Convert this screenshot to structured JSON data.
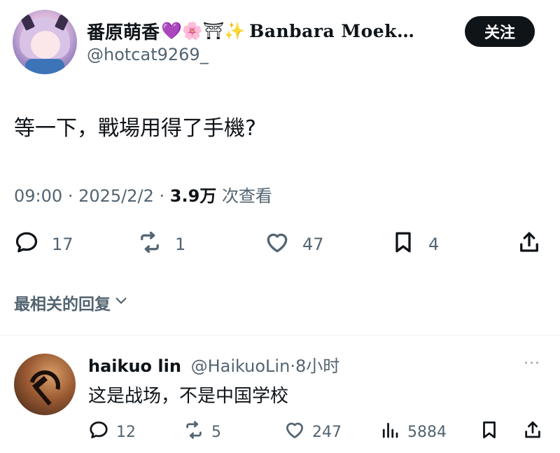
{
  "author": {
    "display_name": "番原萌香",
    "emojis": "💜🌸⛩✨",
    "name_suffix": "Banbara Moek…",
    "handle": "@hotcat9269_"
  },
  "follow_label": "关注",
  "tweet": {
    "text": "等一下，戰場用得了手機?",
    "time": "09:00",
    "date": "2025/2/2",
    "views_count": "3.9万",
    "views_label": "次查看"
  },
  "actions": {
    "replies": "17",
    "retweets": "1",
    "likes": "47",
    "bookmarks": "4"
  },
  "replies_sort_label": "最相关的回复",
  "reply": {
    "name": "haikuo lin",
    "handle": "@HaikuoLin",
    "time": "8小时",
    "more": "···",
    "text": "这是战场，不是中国学校",
    "actions": {
      "replies": "12",
      "retweets": "5",
      "likes": "247",
      "views": "5884"
    }
  },
  "colors": {
    "text_primary": "#0f1419",
    "text_secondary": "#536471",
    "follow_bg": "#0f1419",
    "divider": "#eff3f4"
  },
  "icons": [
    "reply-icon",
    "retweet-icon",
    "like-icon",
    "bookmark-icon",
    "share-icon",
    "views-icon",
    "chevron-down-icon",
    "more-icon"
  ]
}
